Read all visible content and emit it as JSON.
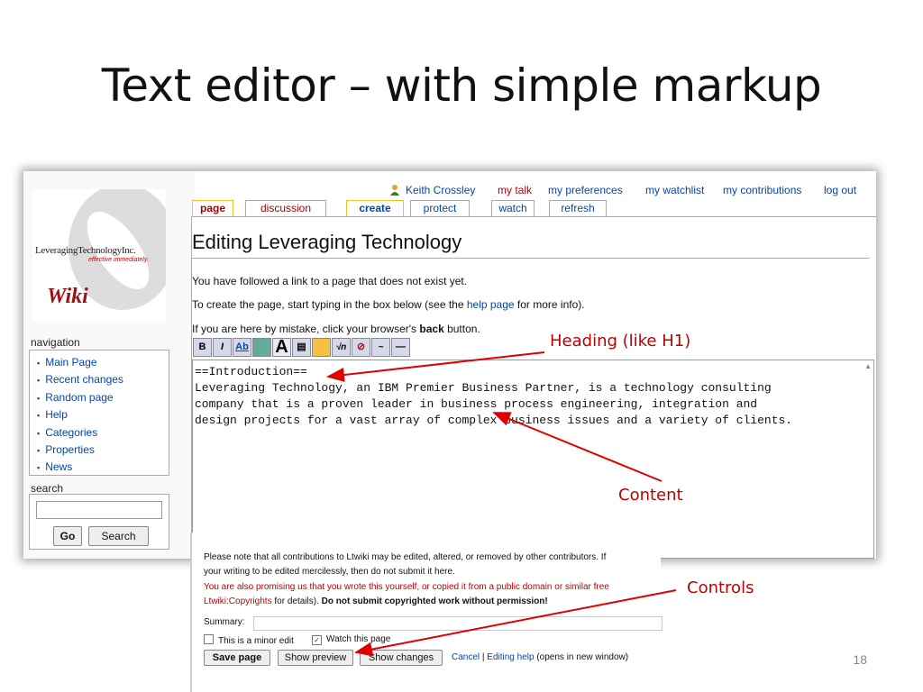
{
  "slide": {
    "title": "Text editor – with simple markup",
    "page_number": "18"
  },
  "wiki": {
    "logo": {
      "company": "LeveragingTechnologyInc.",
      "tagline": "effective immediately.",
      "wiki": "Wiki"
    },
    "user": {
      "name": "Keith Crossley",
      "links": [
        "my talk",
        "my preferences",
        "my watchlist",
        "my contributions",
        "log out"
      ]
    },
    "tabs": [
      "page",
      "discussion",
      "create",
      "protect",
      "watch",
      "refresh"
    ],
    "navigation": {
      "heading": "navigation",
      "items": [
        "Main Page",
        "Recent changes",
        "Random page",
        "Help",
        "Categories",
        "Properties",
        "News"
      ]
    },
    "search": {
      "heading": "search",
      "go": "Go",
      "search": "Search"
    },
    "page_heading": "Editing Leveraging Technology",
    "messages": {
      "line1": "You have followed a link to a page that does not exist yet.",
      "line2_a": "To create the page, start typing in the box below (see the ",
      "line2_link": "help page",
      "line2_b": " for more info).",
      "line3_a": "If you are here by mistake, click your browser's ",
      "line3_bold": "back",
      "line3_b": " button."
    },
    "toolbar_buttons": [
      "B",
      "I",
      "Ab",
      "link-ext",
      "A",
      "img",
      "media",
      "math",
      "nowiki",
      "sig",
      "hr"
    ],
    "editor_text": "==Introduction==\nLeveraging Technology, an IBM Premier Business Partner, is a technology consulting\ncompany that is a proven leader in business process engineering, integration and\ndesign projects for a vast array of complex business issues and a variety of clients."
  },
  "controls": {
    "note1": "Please note that all contributions to Ltwiki may be edited, altered, or removed by other contributors. If",
    "note2": "your writing to be edited mercilessly, then do not submit it here.",
    "note3": "You are also promising us that you wrote this yourself, or copied it from a public domain or similar free",
    "note4_link": "Ltwiki:Copyrights",
    "note4_a": " for details). ",
    "note4_bold": "Do not submit copyrighted work without permission!",
    "summary_label": "Summary:",
    "minor_edit": "This is a minor edit",
    "watch_page": "Watch this page",
    "save": "Save page",
    "preview": "Show preview",
    "changes": "Show changes",
    "cancel": "Cancel",
    "sep": " | ",
    "editing_help": "Editing help",
    "editing_help_tail": " (opens in new window)"
  },
  "callouts": {
    "heading": "Heading (like H1)",
    "content": "Content",
    "controls": "Controls"
  },
  "colors": {
    "link": "#0645ad",
    "red_link": "#ba0000",
    "callout": "#c00000",
    "tab_border": "#fabd23"
  }
}
